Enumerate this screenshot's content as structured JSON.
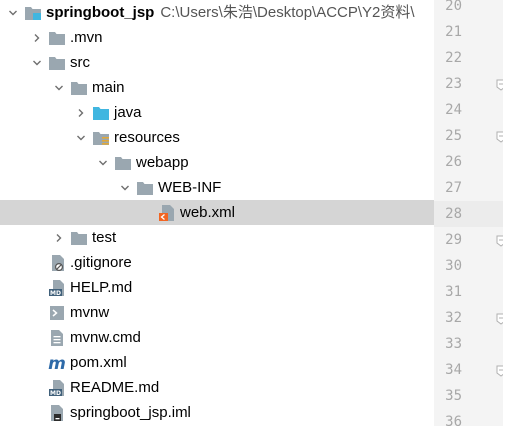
{
  "project_tree": {
    "root": {
      "label": "springboot_jsp",
      "path": "C:\\Users\\朱浩\\Desktop\\ACCP\\Y2资料\\"
    },
    "items": [
      {
        "label": ".mvn",
        "icon": "folder-icon"
      },
      {
        "label": "src",
        "icon": "folder-icon"
      },
      {
        "label": "main",
        "icon": "folder-icon"
      },
      {
        "label": "java",
        "icon": "source-folder-icon"
      },
      {
        "label": "resources",
        "icon": "resources-folder-icon"
      },
      {
        "label": "webapp",
        "icon": "folder-icon"
      },
      {
        "label": "WEB-INF",
        "icon": "folder-icon"
      },
      {
        "label": "web.xml",
        "icon": "xml-file-icon",
        "selected": true
      },
      {
        "label": "test",
        "icon": "folder-icon"
      },
      {
        "label": ".gitignore",
        "icon": "ignore-file-icon"
      },
      {
        "label": "HELP.md",
        "icon": "markdown-file-icon",
        "badge": "MD"
      },
      {
        "label": "mvnw",
        "icon": "script-file-icon"
      },
      {
        "label": "mvnw.cmd",
        "icon": "text-file-icon"
      },
      {
        "label": "pom.xml",
        "icon": "maven-file-icon",
        "badge": "m"
      },
      {
        "label": "README.md",
        "icon": "markdown-file-icon",
        "badge": "MD"
      },
      {
        "label": "springboot_jsp.iml",
        "icon": "iml-file-icon"
      }
    ]
  },
  "editor_gutter": {
    "line_numbers": [
      "20",
      "21",
      "22",
      "23",
      "24",
      "25",
      "26",
      "27",
      "28",
      "29",
      "30",
      "31",
      "32",
      "33",
      "34",
      "35",
      "36"
    ],
    "current_line": "28"
  },
  "colors": {
    "selection": "#d5d5d5",
    "folder": "#9aa7b0",
    "source_folder": "#40b6e0",
    "xml_accent": "#f26522",
    "markdown_badge": "#40607a"
  }
}
